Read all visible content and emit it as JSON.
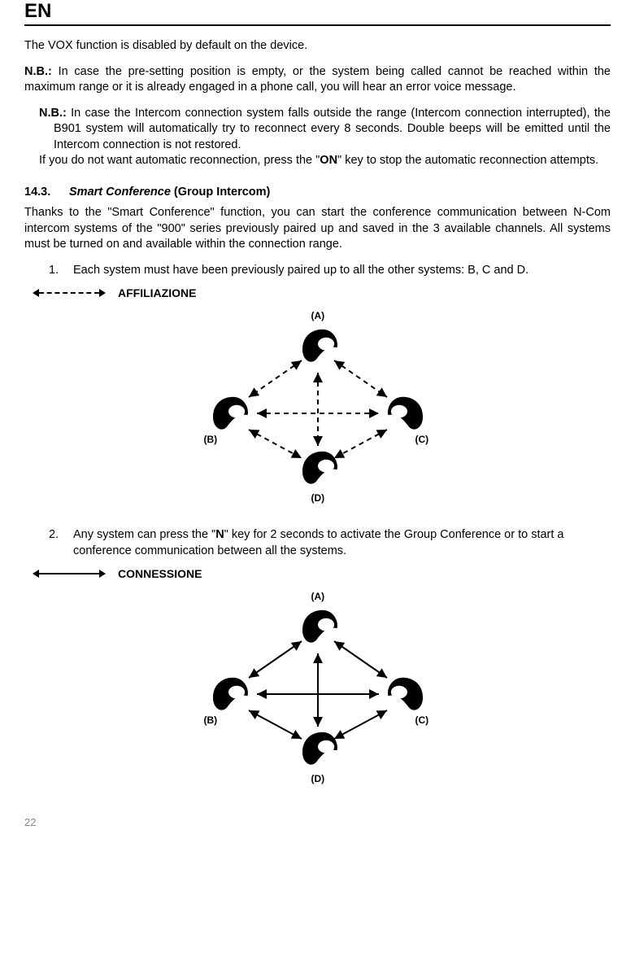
{
  "header": "EN",
  "para1": "The VOX function is disabled by default on the device.",
  "nb1_label": "N.B.:",
  "nb1_text": " In case the pre-setting position is empty, or the system being called cannot be reached within the maximum range or it is already engaged in a phone call, you will hear an error voice message.",
  "nb2_label": "N.B.:",
  "nb2_text1": " In case the Intercom connection system falls outside the range (Intercom connection interrupted), the B901 system will automatically try to reconnect every 8 seconds. Double beeps will be emitted until the Intercom connection is not restored.",
  "nb2_text2_a": "If you do not want automatic reconnection, press the \"",
  "nb2_text2_on": "ON",
  "nb2_text2_b": "\" key to stop the automatic reconnection attempts.",
  "section_num": "14.3.",
  "section_title_italic": "Smart Conference",
  "section_title_rest": " (Group Intercom)",
  "intro": "Thanks to the \"Smart Conference\" function, you can start the conference communication between N-Com intercom systems of the \"900\" series previously paired up and saved in the 3 available channels. All systems must be turned on and available within the connection range.",
  "step1_num": "1.",
  "step1_text": "Each system must have been previously paired up to all the other systems: B, C and D.",
  "label_affiliazione": "AFFILIAZIONE",
  "step2_num": "2.",
  "step2_text_a": "Any system can press the \"",
  "step2_text_n": "N",
  "step2_text_b": "\" key for 2 seconds to activate the Group Conference or to start a conference communication between all the systems.",
  "label_connessione": "CONNESSIONE",
  "node_a": "(A)",
  "node_b": "(B)",
  "node_c": "(C)",
  "node_d": "(D)",
  "page_num": "22"
}
